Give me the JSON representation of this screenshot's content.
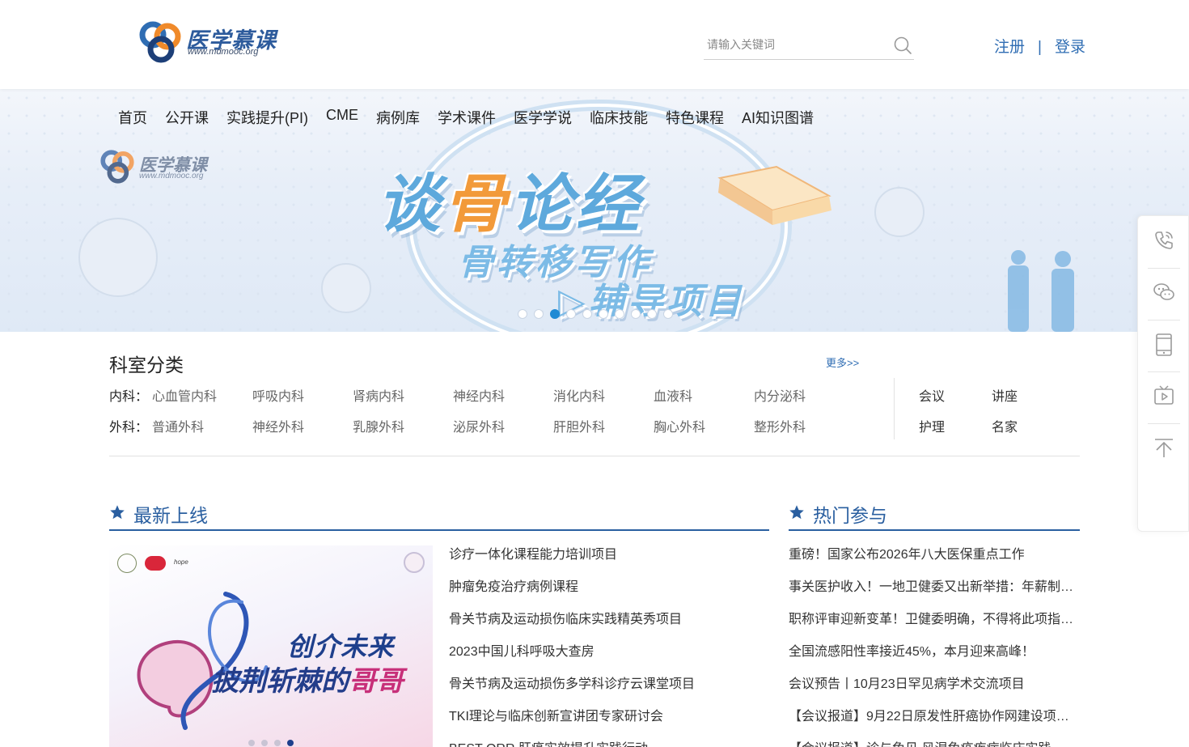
{
  "header": {
    "logo_title": "医学慕课",
    "logo_url": "www.mdmooc.org",
    "search_placeholder": "请输入关键词",
    "register_label": "注册",
    "login_label": "登录",
    "separator": "|"
  },
  "nav": [
    "首页",
    "公开课",
    "实践提升(PI)",
    "CME",
    "病例库",
    "学术课件",
    "医学学说",
    "临床技能",
    "特色课程",
    "AI知识图谱"
  ],
  "banner": {
    "logo_title": "医学慕课",
    "logo_url": "www.mdmooc.org",
    "line1_a": "谈",
    "line1_b": "骨",
    "line1_c": "论经",
    "line2": "骨转移写作",
    "line3": "▷辅导项目",
    "slide_count": 10,
    "active_slide": 3
  },
  "departments": {
    "title": "科室分类",
    "more": "更多>>",
    "internal_label": "内科：",
    "internal": [
      "心血管内科",
      "呼吸内科",
      "肾病内科",
      "神经内科",
      "消化内科",
      "血液科",
      "内分泌科"
    ],
    "surgery_label": "外科：",
    "surgery": [
      "普通外科",
      "神经外科",
      "乳腺外科",
      "泌尿外科",
      "肝胆外科",
      "胸心外科",
      "整形外科"
    ],
    "side": [
      "会议",
      "讲座",
      "护理",
      "名家"
    ]
  },
  "latest": {
    "title": "最新上线",
    "promo_title_1": "创介未来",
    "promo_title_2a": "披荆斩棘的",
    "promo_title_2b": "哥哥",
    "promo_logo_text": "hope",
    "promo_slide_count": 4,
    "promo_active_slide": 4,
    "items": [
      "诊疗一体化课程能力培训项目",
      "肿瘤免疫治疗病例课程",
      "骨关节病及运动损伤临床实践精英秀项目",
      "2023中国儿科呼吸大查房",
      "骨关节病及运动损伤多学科诊疗云课堂项目",
      "TKI理论与临床创新宣讲团专家研讨会",
      "BEST ORR 肝癌实效提升实践行动"
    ]
  },
  "hot": {
    "title": "热门参与",
    "items": [
      "重磅！国家公布2026年八大医保重点工作",
      "事关医护收入！一地卫健委又出新举措：年薪制…",
      "职称评审迎新变革！卫健委明确，不得将此项指…",
      "全国流感阳性率接近45%，本月迎来高峰！",
      "会议预告丨10月23日罕见病学术交流项目",
      "【会议报道】9月22日原发性肝癌协作网建设项…",
      "【会议报道】诊与免见 风湿免疫疾病临床实践能…"
    ]
  },
  "colors": {
    "brand_blue": "#2a5fa0",
    "link_blue": "#2f6db3",
    "active_dot": "#1f8ad4",
    "banner_orange": "#f29a3a"
  },
  "toolbar_icons": [
    "phone-icon",
    "wechat-icon",
    "tablet-icon",
    "video-icon",
    "back-to-top-icon"
  ]
}
